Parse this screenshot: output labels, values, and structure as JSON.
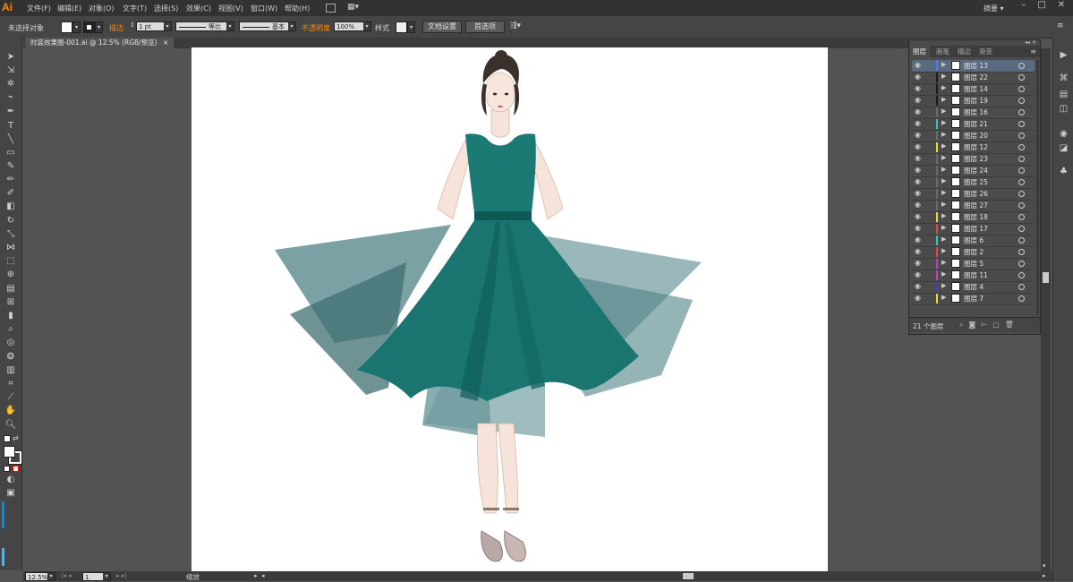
{
  "app": {
    "logo": "Ai",
    "workspace": "摘要"
  },
  "menu": [
    "文件(F)",
    "编辑(E)",
    "对象(O)",
    "文字(T)",
    "选择(S)",
    "效果(C)",
    "视图(V)",
    "窗口(W)",
    "帮助(H)"
  ],
  "window_controls": [
    "–",
    "□",
    "✕"
  ],
  "control_bar": {
    "selection": "未选择对象",
    "stroke_label": "描边",
    "stroke_weight": "1 pt",
    "profile_label": "等比",
    "brush_label": "基本",
    "opacity_label": "不透明度",
    "opacity_value": "100%",
    "style_label": "样式",
    "doc_setup": "文档设置",
    "preferences": "首选项"
  },
  "document": {
    "tab_title": "时装效果图-001.ai @ 12.5% (RGB/预览)"
  },
  "status": {
    "zoom": "12.5%",
    "page": "1",
    "tool_name": "缩放"
  },
  "layers_panel": {
    "tabs": [
      "图层",
      "画笔",
      "描边",
      "渐变"
    ],
    "count_text": "21 个图层",
    "layers": [
      {
        "name": "图层 13",
        "color": "#4a7dff",
        "selected": true
      },
      {
        "name": "图层 22",
        "color": "#1a1a1a",
        "selected": false
      },
      {
        "name": "图层 14",
        "color": "#1a1a1a",
        "selected": false
      },
      {
        "name": "图层 19",
        "color": "#1a1a1a",
        "selected": false
      },
      {
        "name": "图层 16",
        "color": "#6a6a6a",
        "selected": false
      },
      {
        "name": "图层 21",
        "color": "#33c2c2",
        "selected": false
      },
      {
        "name": "图层 20",
        "color": "#6a6a6a",
        "selected": false
      },
      {
        "name": "图层 12",
        "color": "#e8d83a",
        "selected": false
      },
      {
        "name": "图层 23",
        "color": "#6a6a6a",
        "selected": false
      },
      {
        "name": "图层 24",
        "color": "#6a6a6a",
        "selected": false
      },
      {
        "name": "图层 25",
        "color": "#6a6a6a",
        "selected": false
      },
      {
        "name": "图层 26",
        "color": "#6a6a6a",
        "selected": false
      },
      {
        "name": "图层 27",
        "color": "#6a6a6a",
        "selected": false
      },
      {
        "name": "图层 18",
        "color": "#e8d83a",
        "selected": false
      },
      {
        "name": "图层 17",
        "color": "#e04848",
        "selected": false
      },
      {
        "name": "图层 6",
        "color": "#33c2c2",
        "selected": false
      },
      {
        "name": "图层 2",
        "color": "#e04848",
        "selected": false
      },
      {
        "name": "图层 5",
        "color": "#c040c0",
        "selected": false
      },
      {
        "name": "图层 11",
        "color": "#c040c0",
        "selected": false
      },
      {
        "name": "图层 4",
        "color": "#4040c0",
        "selected": false
      },
      {
        "name": "图层 7",
        "color": "#e8d83a",
        "selected": false
      }
    ]
  },
  "colors": {
    "dress": "#1c7a74",
    "dress_dark": "#0f5e5a",
    "overlay": "#5a8a8e",
    "accent": "#ff8a00"
  }
}
